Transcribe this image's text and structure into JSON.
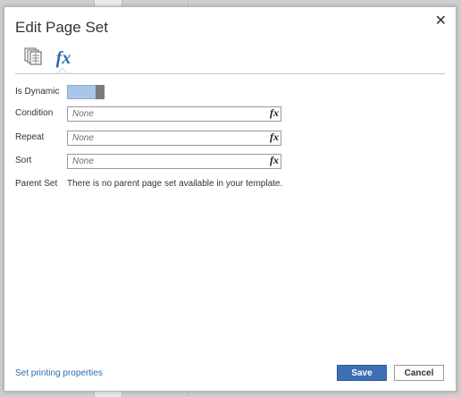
{
  "dialog": {
    "title": "Edit Page Set",
    "close_glyph": "✕"
  },
  "tabs": [
    {
      "icon": "page-set-icon"
    },
    {
      "icon": "fx-icon",
      "label": "fx",
      "selected": true
    }
  ],
  "fields": {
    "is_dynamic": {
      "label": "Is Dynamic",
      "on": true
    },
    "condition": {
      "label": "Condition",
      "placeholder": "None",
      "fx": "fx"
    },
    "repeat": {
      "label": "Repeat",
      "placeholder": "None",
      "fx": "fx"
    },
    "sort": {
      "label": "Sort",
      "placeholder": "None",
      "fx": "fx"
    },
    "parent_set": {
      "label": "Parent Set",
      "value": "There is no parent page set available in your template."
    }
  },
  "footer": {
    "link": "Set printing properties",
    "save": "Save",
    "cancel": "Cancel"
  },
  "colors": {
    "accent": "#3d6fb4",
    "link": "#2b6cb0",
    "toggle_on": "#a9c5eb"
  }
}
